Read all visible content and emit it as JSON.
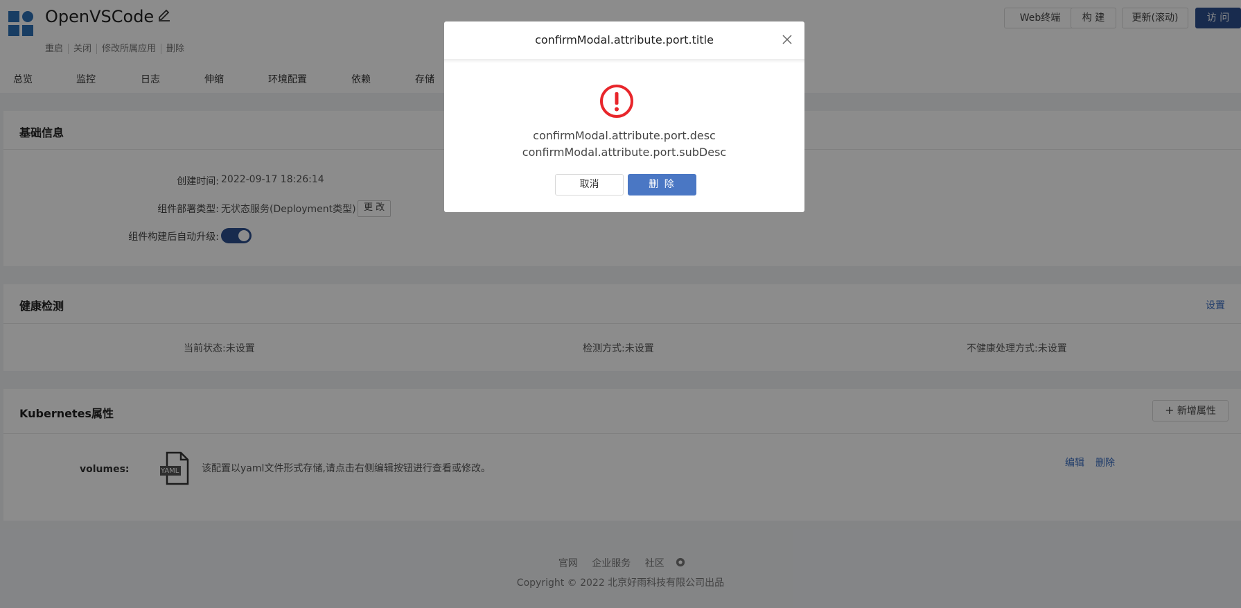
{
  "header": {
    "app_name": "OpenVSCode",
    "actions": [
      "重启",
      "关闭",
      "修改所属应用",
      "删除"
    ],
    "buttons": {
      "web_terminal": "Web终端",
      "build": "构 建",
      "update": "更新(滚动)",
      "visit": "访 问"
    },
    "tabs": [
      "总览",
      "监控",
      "日志",
      "伸缩",
      "环境配置",
      "依赖",
      "存储"
    ]
  },
  "basic_info": {
    "title": "基础信息",
    "created_label": "创建时间:",
    "created_value": "2022-09-17 18:26:14",
    "deploy_type_label": "组件部署类型:",
    "deploy_type_value": "无状态服务(Deployment类型)",
    "change_button": "更 改",
    "auto_upgrade_label": "组件构建后自动升级:",
    "auto_upgrade_on": true
  },
  "health": {
    "title": "健康检测",
    "settings_link": "设置",
    "status": "当前状态:未设置",
    "method": "检测方式:未设置",
    "unhealthy": "不健康处理方式:未设置"
  },
  "k8s": {
    "title": "Kubernetes属性",
    "add_button": "新增属性",
    "volume_label": "volumes:",
    "file_icon_text": "YAML",
    "volume_desc": "该配置以yaml文件形式存储,请点击右侧编辑按钮进行查看或修改。",
    "edit_link": "编辑",
    "delete_link": "删除"
  },
  "footer": {
    "links": [
      "官网",
      "企业服务",
      "社区"
    ],
    "copyright": "Copyright © 2022 北京好雨科技有限公司出品"
  },
  "modal": {
    "title": "confirmModal.attribute.port.title",
    "desc": "confirmModal.attribute.port.desc",
    "sub_desc": "confirmModal.attribute.port.subDesc",
    "cancel": "取消",
    "confirm": "删 除"
  },
  "colors": {
    "primary": "#2d4f8f",
    "danger": "#e8262b",
    "link": "#3a6ec2"
  }
}
